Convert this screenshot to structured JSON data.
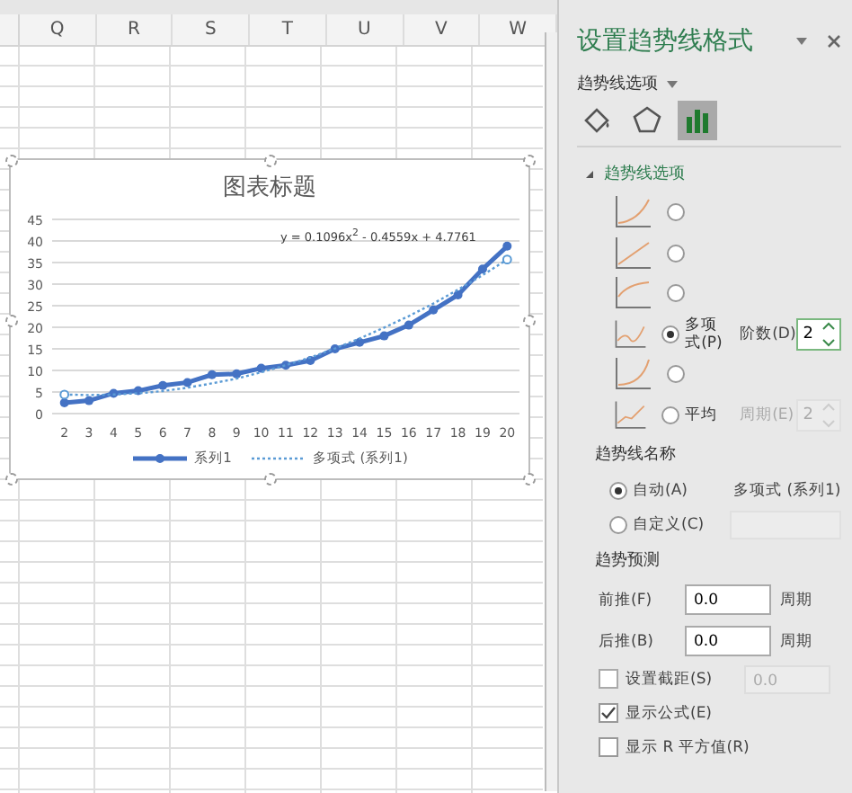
{
  "sheet": {
    "columns": [
      "Q",
      "R",
      "S",
      "T",
      "U",
      "V",
      "W"
    ]
  },
  "chart": {
    "chart_data": {
      "type": "line",
      "title": "图表标题",
      "categories": [
        "2",
        "3",
        "4",
        "5",
        "6",
        "7",
        "8",
        "9",
        "10",
        "11",
        "12",
        "13",
        "14",
        "15",
        "16",
        "17",
        "18",
        "19",
        "20"
      ],
      "ylim": [
        0,
        45
      ],
      "grid": true,
      "legend": "bottom",
      "yticks": [
        0,
        5,
        10,
        15,
        20,
        25,
        30,
        35,
        40,
        45
      ],
      "series": [
        {
          "name": "系列1",
          "color": "#4472c4",
          "marker": "circle",
          "line_style": "solid",
          "values": [
            2.5,
            3,
            4.7,
            5.3,
            6.5,
            7.2,
            9,
            9.2,
            10.5,
            11.2,
            12.3,
            15,
            16.5,
            18,
            20.5,
            24,
            27.5,
            33.5,
            38.8
          ]
        },
        {
          "name": "多项式 (系列1)",
          "color": "#5b9bd5",
          "line_style": "dotted",
          "values": [
            4.4,
            4.3,
            4.4,
            4.7,
            5.2,
            6,
            7,
            8.1,
            9.6,
            11.2,
            13,
            15.1,
            17.4,
            19.9,
            22.6,
            25.5,
            28.7,
            32.1,
            35.7
          ]
        }
      ],
      "annotations": [
        "y = 0.1096x$^{2}$ - 0.4559x + 4.7761"
      ]
    }
  },
  "panel": {
    "title": "设置趋势线格式",
    "menu": "趋势线选项",
    "tabs": [
      {
        "kind": "fill",
        "selected": false
      },
      {
        "kind": "effects",
        "selected": false
      },
      {
        "kind": "options",
        "selected": true
      }
    ],
    "section": {
      "title": "趋势线选项",
      "expanded": true
    },
    "types": [
      {
        "selected": false
      },
      {
        "selected": false
      },
      {
        "selected": false
      },
      {
        "label": "多项式(P)",
        "selected": true,
        "param": {
          "label": "阶数(D)",
          "value": "2",
          "disabled": false
        }
      },
      {
        "selected": false
      },
      {
        "label": "平均",
        "selected": false,
        "param": {
          "label": "周期(E)",
          "value": "2",
          "disabled": true
        }
      }
    ],
    "name": {
      "heading": "趋势线名称",
      "options": [
        {
          "label": "自动(A)",
          "selected": true,
          "value": "多项式 (系列1)"
        },
        {
          "label": "自定义(C)",
          "selected": false,
          "field_disabled": true
        }
      ]
    },
    "forecast": {
      "heading": "趋势预测",
      "rows": [
        {
          "label": "前推(F)",
          "value": "0.0",
          "unit": "周期"
        },
        {
          "label": "后推(B)",
          "value": "0.0",
          "unit": "周期"
        }
      ]
    },
    "checks": [
      {
        "label": "设置截距(S)",
        "checked": false,
        "value": "0.0",
        "disabled": true
      },
      {
        "label": "显示公式(E)",
        "checked": true
      },
      {
        "label": "显示 R 平方值(R)",
        "checked": false
      }
    ]
  }
}
